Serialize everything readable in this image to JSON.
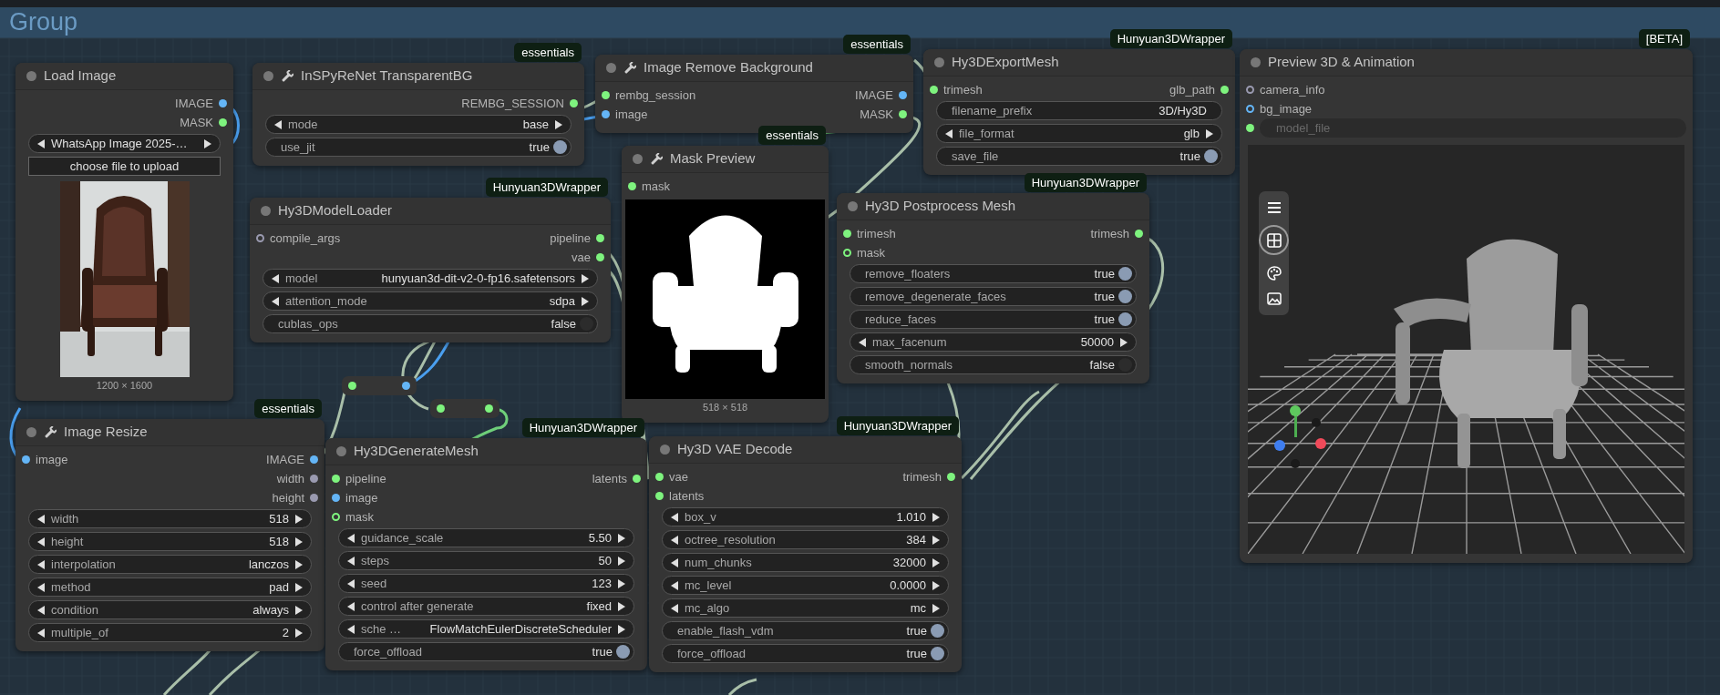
{
  "group": {
    "title": "Group"
  },
  "nodes": [
    {
      "title": "Load Image",
      "tool_icon": false,
      "outputs": [
        {
          "label": "IMAGE",
          "color": "#64b5f6",
          "optional": false
        },
        {
          "label": "MASK",
          "color": "#7ef37e",
          "optional": false
        }
      ],
      "widgets": [
        {
          "kind": "combo",
          "value": "WhatsApp Image 2025-…"
        },
        {
          "kind": "button",
          "label": "choose file to upload"
        }
      ],
      "image": {
        "caption": "1200 × 1600"
      }
    },
    {
      "title": "InSPyReNet TransparentBG",
      "badge": "essentials",
      "tool_icon": true,
      "outputs": [
        {
          "label": "REMBG_SESSION",
          "color": "#7ef37e",
          "optional": false
        }
      ],
      "widgets": [
        {
          "kind": "combo",
          "label": "mode",
          "value": "base"
        },
        {
          "kind": "toggle",
          "label": "use_jit",
          "value": "true",
          "on": true
        }
      ]
    },
    {
      "title": "Image Remove Background",
      "badge": "essentials",
      "tool_icon": true,
      "inputs": [
        {
          "label": "rembg_session",
          "color": "#7ef37e",
          "optional": false
        },
        {
          "label": "image",
          "color": "#64b5f6",
          "optional": false
        }
      ],
      "outputs": [
        {
          "label": "IMAGE",
          "color": "#64b5f6",
          "optional": false
        },
        {
          "label": "MASK",
          "color": "#7ef37e",
          "optional": false
        }
      ]
    },
    {
      "title": "Hy3DExportMesh",
      "badge": "Hunyuan3DWrapper",
      "tool_icon": false,
      "inputs": [
        {
          "label": "trimesh",
          "color": "#7ef37e",
          "optional": false
        }
      ],
      "outputs": [
        {
          "label": "glb_path",
          "color": "#7ef37e",
          "optional": false
        }
      ],
      "widgets": [
        {
          "kind": "text",
          "label": "filename_prefix",
          "value": "3D/Hy3D"
        },
        {
          "kind": "combo",
          "label": "file_format",
          "value": "glb"
        },
        {
          "kind": "toggle",
          "label": "save_file",
          "value": "true",
          "on": true
        }
      ]
    },
    {
      "title": "Preview 3D & Animation",
      "badge": "[BETA]",
      "tool_icon": false,
      "inputs": [
        {
          "label": "camera_info",
          "color": "#9a9ab0",
          "optional": true
        },
        {
          "label": "bg_image",
          "color": "#64b5f6",
          "optional": true
        },
        {
          "placeholder": "model_file",
          "color": "#7ef37e",
          "optional": false
        }
      ],
      "image": {
        "kind": "viewport"
      }
    },
    {
      "title": "Mask Preview",
      "badge": "essentials",
      "tool_icon": true,
      "inputs": [
        {
          "label": "mask",
          "color": "#7ef37e",
          "optional": false
        }
      ],
      "image": {
        "kind": "mask",
        "caption": "518 × 518"
      }
    },
    {
      "title": "Hy3DModelLoader",
      "badge": "Hunyuan3DWrapper",
      "tool_icon": false,
      "inputs": [
        {
          "label": "compile_args",
          "color": "#9a9ab0",
          "optional": true
        }
      ],
      "outputs": [
        {
          "label": "pipeline",
          "color": "#7ef37e",
          "optional": false
        },
        {
          "label": "vae",
          "color": "#7ef37e",
          "optional": false
        }
      ],
      "widgets": [
        {
          "kind": "combo",
          "label": "model",
          "value": "hunyuan3d-dit-v2-0-fp16.safetensors"
        },
        {
          "kind": "combo",
          "label": "attention_mode",
          "value": "sdpa"
        },
        {
          "kind": "toggle",
          "label": "cublas_ops",
          "value": "false",
          "on": false
        }
      ]
    },
    {
      "title": "Hy3D Postprocess Mesh",
      "badge": "Hunyuan3DWrapper",
      "tool_icon": false,
      "inputs": [
        {
          "label": "trimesh",
          "color": "#7ef37e",
          "optional": false
        },
        {
          "label": "mask",
          "color": "#7ef37e",
          "optional": true
        }
      ],
      "outputs": [
        {
          "label": "trimesh",
          "color": "#7ef37e",
          "optional": false
        }
      ],
      "widgets": [
        {
          "kind": "toggle",
          "label": "remove_floaters",
          "value": "true",
          "on": true
        },
        {
          "kind": "toggle",
          "label": "remove_degenerate_faces",
          "value": "true",
          "on": true
        },
        {
          "kind": "toggle",
          "label": "reduce_faces",
          "value": "true",
          "on": true
        },
        {
          "kind": "number",
          "label": "max_facenum",
          "value": "50000"
        },
        {
          "kind": "toggle",
          "label": "smooth_normals",
          "value": "false",
          "on": false
        }
      ]
    },
    {
      "title": "Image Resize",
      "badge": "essentials",
      "tool_icon": true,
      "inputs": [
        {
          "label": "image",
          "color": "#64b5f6",
          "optional": false
        }
      ],
      "outputs": [
        {
          "label": "IMAGE",
          "color": "#64b5f6",
          "optional": false
        },
        {
          "label": "width",
          "color": "#9a9ab0",
          "optional": false
        },
        {
          "label": "height",
          "color": "#9a9ab0",
          "optional": false
        }
      ],
      "widgets": [
        {
          "kind": "number",
          "label": "width",
          "value": "518"
        },
        {
          "kind": "number",
          "label": "height",
          "value": "518"
        },
        {
          "kind": "combo",
          "label": "interpolation",
          "value": "lanczos"
        },
        {
          "kind": "combo",
          "label": "method",
          "value": "pad"
        },
        {
          "kind": "combo",
          "label": "condition",
          "value": "always"
        },
        {
          "kind": "number",
          "label": "multiple_of",
          "value": "2"
        }
      ]
    },
    {
      "title": "Hy3DGenerateMesh",
      "badge": "Hunyuan3DWrapper",
      "tool_icon": false,
      "inputs": [
        {
          "label": "pipeline",
          "color": "#7ef37e",
          "optional": false
        },
        {
          "label": "image",
          "color": "#64b5f6",
          "optional": false
        },
        {
          "label": "mask",
          "color": "#7ef37e",
          "optional": true
        }
      ],
      "outputs": [
        {
          "label": "latents",
          "color": "#7ef37e",
          "optional": false
        }
      ],
      "widgets": [
        {
          "kind": "number",
          "label": "guidance_scale",
          "value": "5.50"
        },
        {
          "kind": "number",
          "label": "steps",
          "value": "50"
        },
        {
          "kind": "number",
          "label": "seed",
          "value": "123"
        },
        {
          "kind": "combo",
          "label": "control after generate",
          "value": "fixed"
        },
        {
          "kind": "combo",
          "label": "sche …",
          "value": "FlowMatchEulerDiscreteScheduler"
        },
        {
          "kind": "toggle",
          "label": "force_offload",
          "value": "true",
          "on": true
        }
      ]
    },
    {
      "title": "Hy3D VAE Decode",
      "badge": "Hunyuan3DWrapper",
      "tool_icon": false,
      "inputs": [
        {
          "label": "vae",
          "color": "#7ef37e",
          "optional": false
        },
        {
          "label": "latents",
          "color": "#7ef37e",
          "optional": false
        }
      ],
      "outputs": [
        {
          "label": "trimesh",
          "color": "#7ef37e",
          "optional": false
        }
      ],
      "widgets": [
        {
          "kind": "number",
          "label": "box_v",
          "value": "1.010"
        },
        {
          "kind": "number",
          "label": "octree_resolution",
          "value": "384"
        },
        {
          "kind": "number",
          "label": "num_chunks",
          "value": "32000"
        },
        {
          "kind": "number",
          "label": "mc_level",
          "value": "0.0000"
        },
        {
          "kind": "combo",
          "label": "mc_algo",
          "value": "mc"
        },
        {
          "kind": "toggle",
          "label": "enable_flash_vdm",
          "value": "true",
          "on": true
        },
        {
          "kind": "toggle",
          "label": "force_offload",
          "value": "true",
          "on": true
        }
      ]
    }
  ],
  "reroutes": [
    {
      "in": {
        "color": "#7ef37e"
      },
      "out": {
        "color": "#64b5f6"
      }
    },
    {
      "in": {
        "color": "#7ef37e"
      },
      "out": {
        "color": "#7ef37e"
      }
    }
  ]
}
